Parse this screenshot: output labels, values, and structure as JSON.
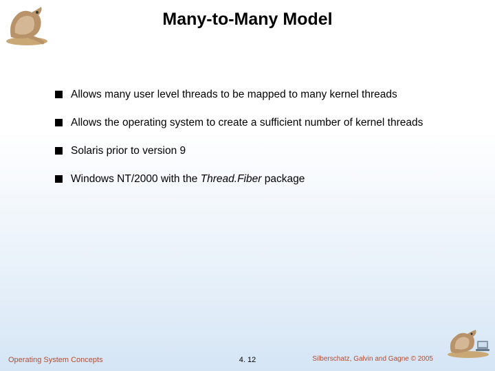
{
  "title": "Many-to-Many Model",
  "bullets": [
    {
      "html": "Allows many user level threads to be mapped to many kernel threads"
    },
    {
      "html": "Allows the  operating system to create a sufficient number of kernel threads"
    },
    {
      "html": "Solaris prior to version 9"
    },
    {
      "html": "Windows NT/2000 with the <em>Thread.Fiber</em> package"
    }
  ],
  "footer": {
    "left": "Operating System Concepts",
    "center": "4. 12",
    "right": "Silberschatz, Galvin and Gagne © 2005"
  }
}
